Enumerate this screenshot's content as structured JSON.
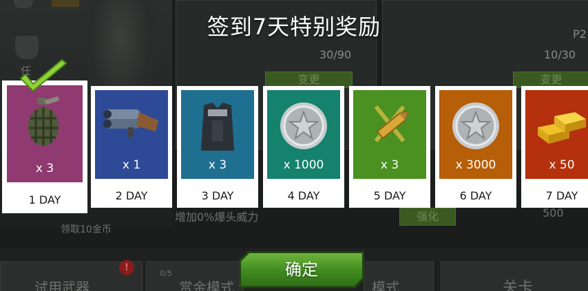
{
  "background": {
    "ammo_left": "30/90",
    "ammo_right": "10/30",
    "weapon_code": "P2",
    "change_label_1": "变更",
    "change_label_2": "变更",
    "upgrade_label": "强化",
    "upgrade_value": "500",
    "buff_text": "增加0%爆头威力",
    "free_coins_text": "领取10金币",
    "trial_weapon": "试用武器",
    "bounty_mode": "赏金模式",
    "mode_label": "模式",
    "stage_label": "关卡",
    "progress_label": "0/5",
    "badge_mark": "!",
    "task_label": "任"
  },
  "dialog": {
    "title": "签到7天特别奖励",
    "confirm_label": "确定",
    "rewards": [
      {
        "day": "1 DAY",
        "count": "x 3",
        "icon": "grenade-icon",
        "color": "#8f3a70",
        "claimed": true
      },
      {
        "day": "2 DAY",
        "count": "x 1",
        "icon": "launcher-icon",
        "color": "#2e4a96"
      },
      {
        "day": "3 DAY",
        "count": "x 3",
        "icon": "armor-vest-icon",
        "color": "#1f6f91"
      },
      {
        "day": "4 DAY",
        "count": "x 1000",
        "icon": "silver-coin-icon",
        "color": "#14826c"
      },
      {
        "day": "5 DAY",
        "count": "x 3",
        "icon": "bullet-icon",
        "color": "#4a9121"
      },
      {
        "day": "6 DAY",
        "count": "x 3000",
        "icon": "silver-coin-icon",
        "color": "#b75e08"
      },
      {
        "day": "7 DAY",
        "count": "x 50",
        "icon": "gold-bars-icon",
        "color": "#b5300c"
      }
    ]
  }
}
